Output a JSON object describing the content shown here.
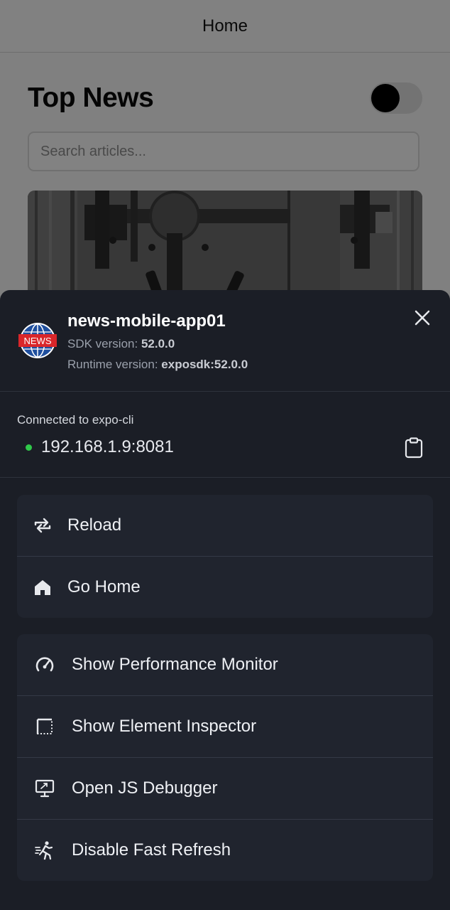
{
  "background": {
    "nav_title": "Home",
    "page_title": "Top News",
    "search": {
      "placeholder": "Search articles...",
      "value": ""
    }
  },
  "dev_menu": {
    "app_name": "news-mobile-app01",
    "app_icon_text": "NEWS",
    "sdk_label": "SDK version: ",
    "sdk_value": "52.0.0",
    "runtime_label": "Runtime version: ",
    "runtime_value": "exposdk:52.0.0",
    "connection_label": "Connected to expo-cli",
    "connection_url": "192.168.1.9:8081",
    "status_color": "#30c94a",
    "group1": [
      {
        "label": "Reload",
        "icon": "reload-icon"
      },
      {
        "label": "Go Home",
        "icon": "home-icon"
      }
    ],
    "group2": [
      {
        "label": "Show Performance Monitor",
        "icon": "speedometer-icon"
      },
      {
        "label": "Show Element Inspector",
        "icon": "inspector-icon"
      },
      {
        "label": "Open JS Debugger",
        "icon": "debugger-icon"
      },
      {
        "label": "Disable Fast Refresh",
        "icon": "run-icon"
      }
    ]
  }
}
